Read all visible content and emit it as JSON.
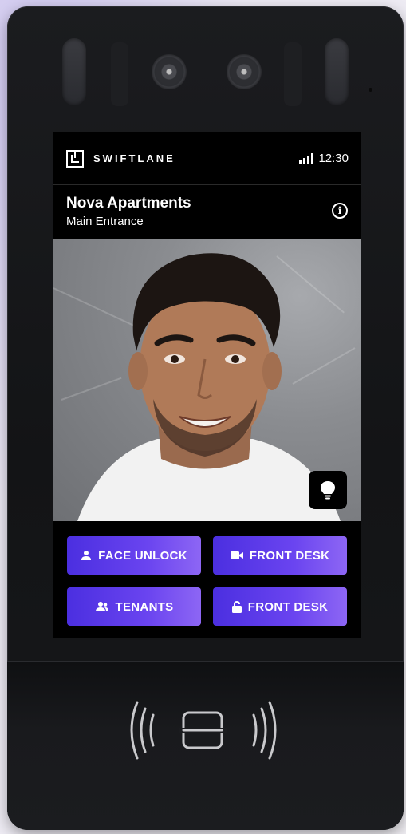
{
  "brand": {
    "name": "SWIFTLANE"
  },
  "status": {
    "time": "12:30"
  },
  "location": {
    "title": "Nova Apartments",
    "subtitle": "Main Entrance"
  },
  "actions": [
    {
      "label": "FACE UNLOCK",
      "icon": "person-icon"
    },
    {
      "label": "FRONT DESK",
      "icon": "video-camera-icon"
    },
    {
      "label": "TENANTS",
      "icon": "people-icon"
    },
    {
      "label": "FRONT DESK",
      "icon": "unlock-icon"
    }
  ],
  "colors": {
    "accent_start": "#4b2fe0",
    "accent_end": "#8d66f4",
    "device": "#17181a"
  }
}
